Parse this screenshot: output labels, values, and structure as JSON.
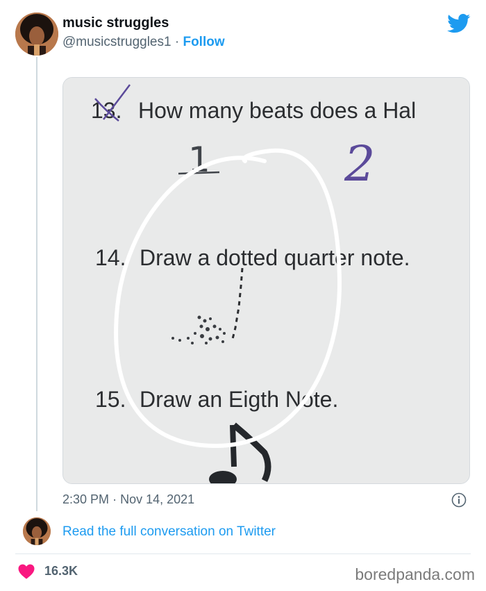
{
  "header": {
    "display_name": "music struggles",
    "handle": "@musicstruggles1",
    "separator": "·",
    "follow_label": "Follow",
    "platform_icon": "twitter-bird-icon",
    "accent_color": "#1d9bf0"
  },
  "photo": {
    "line_13_number": "13.",
    "line_13_text": "How many beats does a Hal",
    "handwritten_1": "1",
    "handwritten_2": "2",
    "line_14_number": "14.",
    "line_14_text": "Draw a dotted quarter note.",
    "line_15_number": "15.",
    "line_15_text": "Draw an Eigth Note."
  },
  "footer": {
    "time": "2:30 PM",
    "separator": "·",
    "date": "Nov 14, 2021",
    "info_icon": "info-icon",
    "read_conversation": "Read the full conversation on Twitter",
    "like_count": "16.3K",
    "like_color": "#f91880",
    "credit": "boredpanda.com"
  }
}
